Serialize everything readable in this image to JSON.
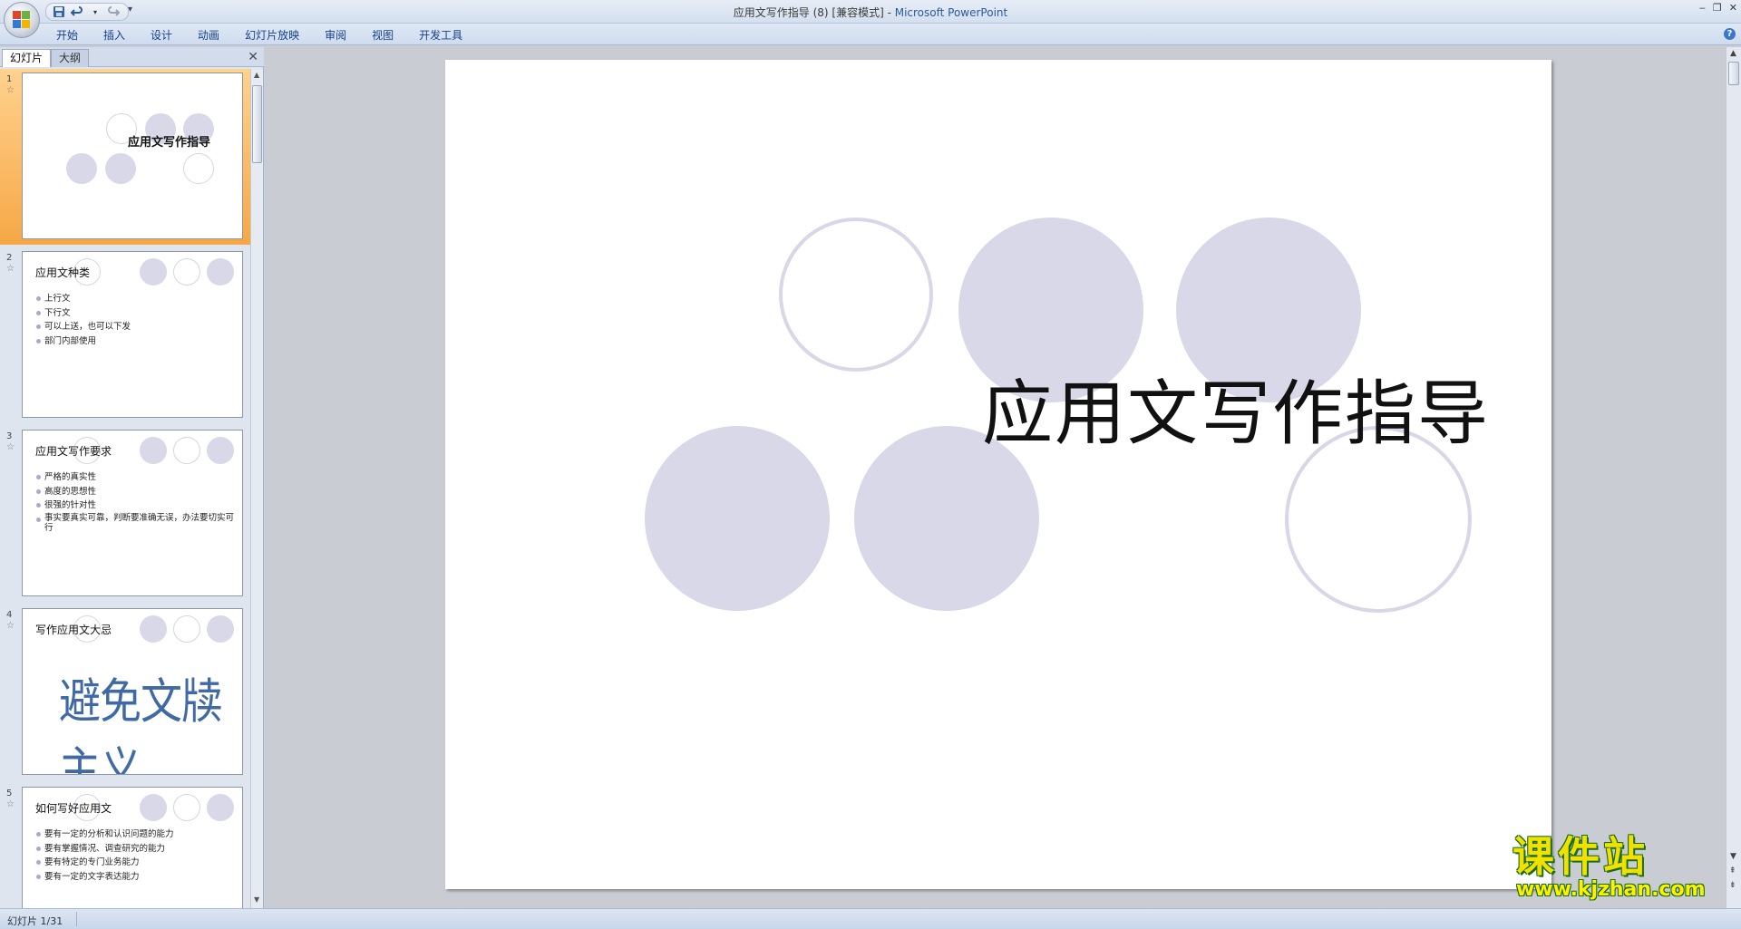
{
  "window": {
    "title_doc": "应用文写作指导 (8) [兼容模式] - ",
    "title_app": "Microsoft PowerPoint",
    "controls": [
      "‒",
      "❐",
      "✕"
    ]
  },
  "quick_access": {
    "icons": [
      "save-icon",
      "undo-icon",
      "redo-icon"
    ],
    "more": "▾"
  },
  "ribbon": {
    "tabs": [
      "开始",
      "插入",
      "设计",
      "动画",
      "幻灯片放映",
      "审阅",
      "视图",
      "开发工具"
    ],
    "help": "?"
  },
  "left_pane": {
    "tabs": [
      "幻灯片",
      "大纲"
    ],
    "close": "✕",
    "slides": [
      {
        "num": "1",
        "title": "应用文写作指导",
        "selected": true
      },
      {
        "num": "2",
        "title": "应用文种类",
        "bullets": [
          "上行文",
          "下行文",
          "可以上送，也可以下发",
          "部门内部使用"
        ]
      },
      {
        "num": "3",
        "title": "应用文写作要求",
        "bullets": [
          "严格的真实性",
          "高度的思想性",
          "很强的针对性",
          "事实要真实可靠，判断要准确无误，办法要切实可行"
        ]
      },
      {
        "num": "4",
        "title": "写作应用文大忌",
        "big_text": "避免文牍主义"
      },
      {
        "num": "5",
        "title": "如何写好应用文",
        "bullets": [
          "要有一定的分析和认识问题的能力",
          "要有掌握情况、调查研究的能力",
          "要有特定的专门业务能力",
          "要有一定的文字表达能力"
        ]
      }
    ]
  },
  "slide": {
    "title": "应用文写作指导",
    "circle_fill_color": "#d8d8e8"
  },
  "status": {
    "slide_counter": "幻灯片 1/31"
  },
  "watermark": {
    "top": "课件站",
    "bottom": "www.kjzhan.com"
  },
  "colors": {
    "selected_thumb": "#f6a746",
    "ribbon_text": "#15428b",
    "slide4_text": "#3f6aa6"
  }
}
